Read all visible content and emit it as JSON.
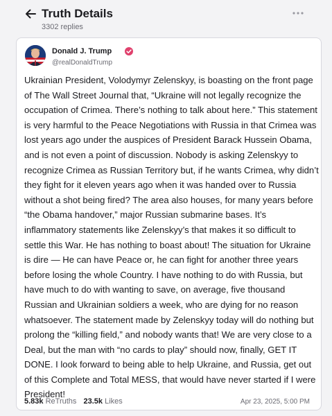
{
  "header": {
    "title": "Truth Details",
    "reply_count": "3302 replies"
  },
  "post": {
    "author_name": "Donald J. Trump",
    "author_handle": "@realDonaldTrump",
    "body": "Ukrainian President, Volodymyr Zelenskyy, is boasting on the front page of The Wall Street Journal that, “Ukraine will not legally recognize the occupation of Crimea. There’s nothing to talk about here.” This statement is very harmful to the Peace Negotiations with Russia in that Crimea was lost years ago under the auspices of President Barack Hussein Obama, and is not even a point of discussion. Nobody is asking Zelenskyy to recognize Crimea as Russian Territory but, if he wants Crimea, why didn’t they fight for it eleven years ago when it was handed over to Russia without a shot being fired? The area also houses, for many years before “the Obama handover,” major Russian submarine bases. It’s inflammatory statements like Zelenskyy’s that makes it so difficult to settle this War. He has nothing to boast about! The situation for Ukraine is dire — He can have Peace or, he can fight for another three years before losing the whole Country. I have nothing to do with Russia, but have much to do with wanting to save, on average, five thousand Russian and Ukrainian soldiers a week, who are dying for no reason whatsoever. The statement made by Zelenskyy today will do nothing but prolong the “killing field,” and nobody wants that! We are very close to a Deal, but the man with “no cards to play” should now, finally, GET IT DONE. I look forward to being able to help Ukraine, and Russia, get out of this Complete and Total MESS, that would have never started if I were President!",
    "retruths_count": "5.83k",
    "retruths_label": "ReTruths",
    "likes_count": "23.5k",
    "likes_label": "Likes",
    "timestamp": "Apr 23, 2025, 5:00 PM"
  },
  "icons": {
    "back": "arrow-left-icon",
    "more": "more-horizontal-icon",
    "verified": "verified-badge-icon"
  },
  "colors": {
    "verified_badge": "#e0416d",
    "muted_text": "#6b6b73",
    "card_border": "#d7d7de",
    "background": "#f3f3f5"
  }
}
